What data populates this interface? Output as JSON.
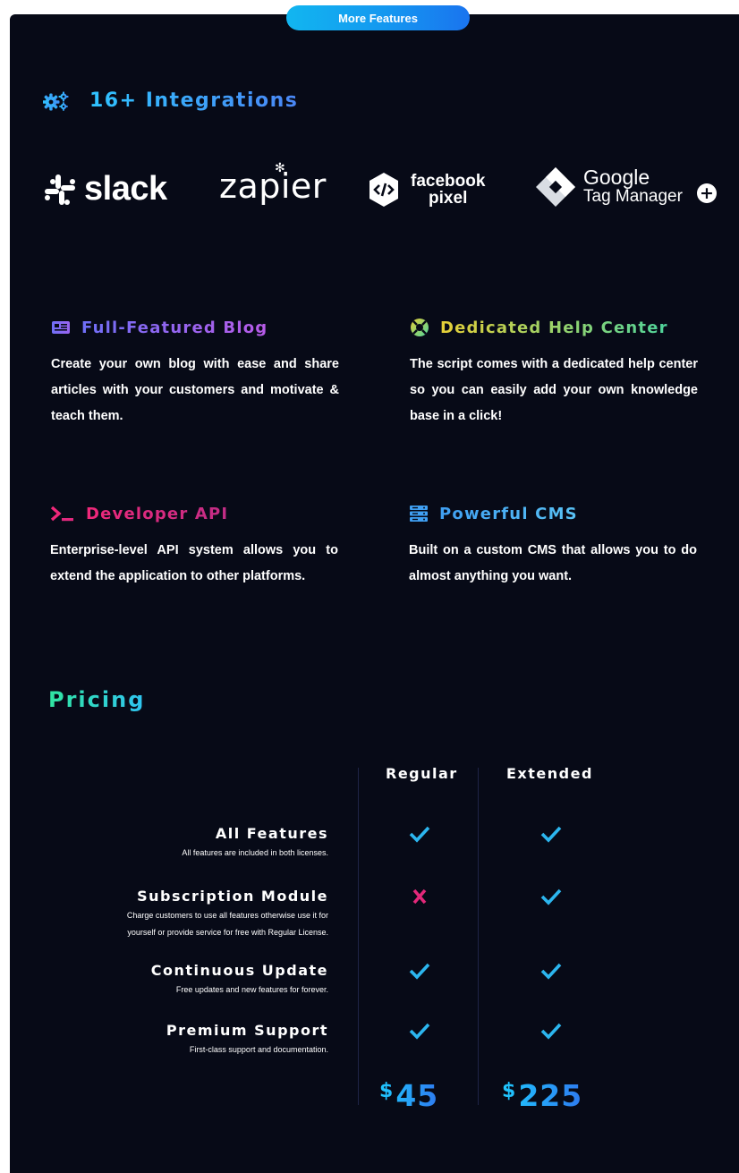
{
  "header": {
    "more_features_label": "More Features"
  },
  "integrations": {
    "title": "16+ Integrations",
    "icon": "gears-icon",
    "logos": {
      "slack": "slack",
      "zapier": "zapier",
      "facebook_pixel_line1": "facebook",
      "facebook_pixel_line2": "pixel",
      "gtm_line1": "Google",
      "gtm_line2": "Tag Manager"
    },
    "more_icon": "plus-circle-icon"
  },
  "features": [
    {
      "title": "Full-Featured Blog",
      "icon": "blog-icon",
      "description": "Create your own blog with ease and share articles with your customers and motivate & teach them."
    },
    {
      "title": "Dedicated Help Center",
      "icon": "lifebuoy-icon",
      "description": "The script comes with a dedicated help center so you can easily add your own knowledge base in a click!"
    },
    {
      "title": "Developer API",
      "icon": "terminal-icon",
      "description": "Enterprise-level API system allows you to extend the application to other platforms."
    },
    {
      "title": "Powerful CMS",
      "icon": "server-icon",
      "description": "Built on a custom CMS that allows you to do almost anything you want."
    }
  ],
  "pricing": {
    "title": "Pricing",
    "columns": [
      "Regular",
      "Extended"
    ],
    "rows": [
      {
        "title": "All Features",
        "description": "All features are included in both licenses.",
        "regular": true,
        "extended": true
      },
      {
        "title": "Subscription Module",
        "description_line1": "Charge customers to use all features otherwise use it for",
        "description_line2": "yourself or provide service for free with Regular License.",
        "regular": false,
        "extended": true
      },
      {
        "title": "Continuous Update",
        "description": "Free updates and new features for forever.",
        "regular": true,
        "extended": true
      },
      {
        "title": "Premium Support",
        "description": "First-class support and documentation.",
        "regular": true,
        "extended": true
      }
    ],
    "prices": [
      {
        "currency": "$",
        "amount": "45"
      },
      {
        "currency": "$",
        "amount": "225"
      }
    ]
  },
  "colors": {
    "background": "#070a17",
    "check": "#2cb6ef",
    "cross": "#e3287a",
    "accent_blue": "#1497f0"
  }
}
